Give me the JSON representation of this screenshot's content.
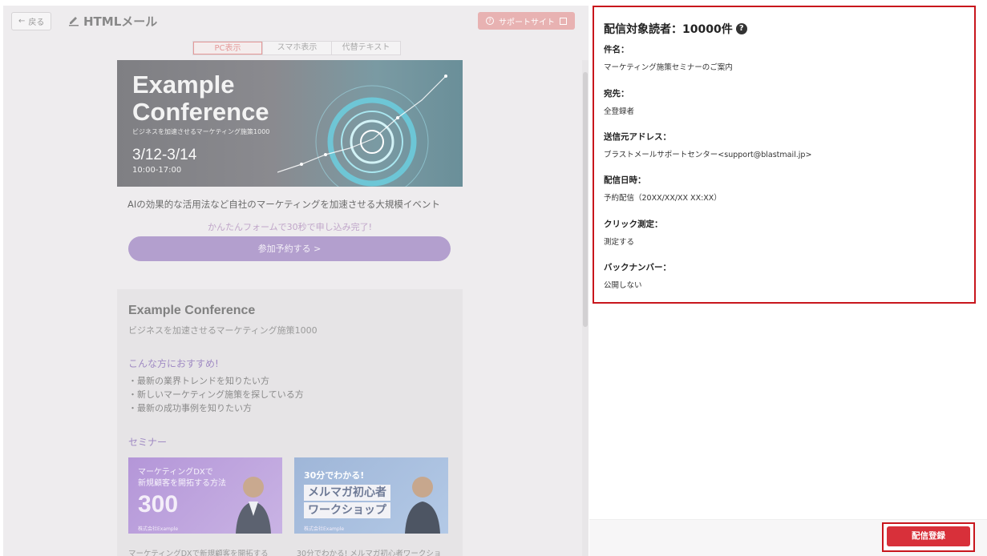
{
  "header": {
    "back_label": "戻る",
    "title": "HTMLメール",
    "support_label": "サポートサイト"
  },
  "view_tabs": [
    {
      "label": "PC表示",
      "active": true
    },
    {
      "label": "スマホ表示",
      "active": false
    },
    {
      "label": "代替テキスト",
      "active": false
    }
  ],
  "email_preview": {
    "hero": {
      "title_line1": "Example",
      "title_line2": "Conference",
      "subtitle": "ビジネスを加速させるマーケティング施策1000",
      "date": "3/12-3/14",
      "time": "10:00-17:00"
    },
    "tagline": "AIの効果的な活用法など自社のマーケティングを加速させる大規模イベント",
    "form_note": "かんたんフォームで30秒で申し込み完了!",
    "cta_label": "参加予約する >",
    "card": {
      "title": "Example Conference",
      "subtitle": "ビジネスを加速させるマーケティング施策1000",
      "recommend_title": "こんな方におすすめ!",
      "recommend_items": [
        "・最新の業界トレンドを知りたい方",
        "・新しいマーケティング施策を探している方",
        "・最新の成功事例を知りたい方"
      ],
      "seminar_heading": "セミナー",
      "seminars": [
        {
          "line1": "マーケティングDXで",
          "line2": "新規顧客を開拓する方法",
          "number": "300",
          "company": "株式会社Example",
          "caption": "マーケティングDXで新規顧客を開拓する"
        },
        {
          "line1": "30分でわかる!",
          "box1": "メルマガ初心者",
          "box2": "ワークショップ",
          "company": "株式会社Example",
          "caption": "30分でわかる! メルマガ初心者ワークショ"
        }
      ]
    }
  },
  "delivery_info": {
    "title": "配信対象読者：10000件",
    "fields": [
      {
        "label": "件名：",
        "value": "マーケティング施策セミナーのご案内"
      },
      {
        "label": "宛先：",
        "value": "全登録者"
      },
      {
        "label": "送信元アドレス：",
        "value": "ブラストメールサポートセンター<support@blastmail.jp>"
      },
      {
        "label": "配信日時：",
        "value": "予約配信（20XX/XX/XX XX:XX）"
      },
      {
        "label": "クリック測定：",
        "value": "測定する"
      },
      {
        "label": "バックナンバー：",
        "value": "公開しない"
      }
    ]
  },
  "footer": {
    "submit_label": "配信登録"
  },
  "colors": {
    "accent_red": "#c8161d",
    "submit_red": "#d8303a",
    "cta_purple": "#b39fce"
  }
}
